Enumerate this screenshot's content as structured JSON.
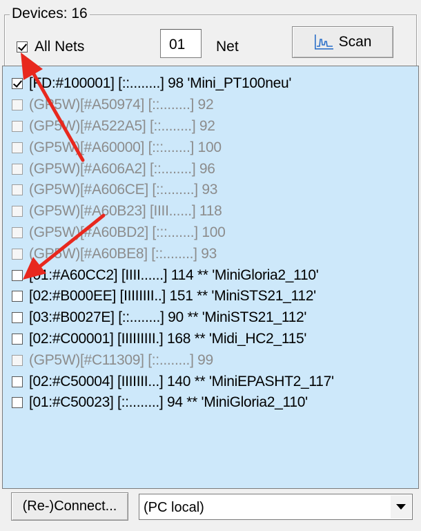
{
  "group": {
    "title": "Devices: 16"
  },
  "toolbar": {
    "all_nets_label": "All Nets",
    "all_nets_checked": true,
    "net_value": "01",
    "net_label": "Net",
    "scan_label": "Scan",
    "scan_icon": "chart-icon"
  },
  "devices": [
    {
      "label": "[FD:#100001] [::........] 98 'Mini_PT100neu'",
      "checked": true,
      "dim": false
    },
    {
      "label": "(GP5W)[#A50974] [::........] 92",
      "checked": false,
      "dim": true
    },
    {
      "label": "(GP5W)[#A522A5] [::........] 92",
      "checked": false,
      "dim": true
    },
    {
      "label": "(GP5W)[#A60000] [:::.......] 100",
      "checked": false,
      "dim": true
    },
    {
      "label": "(GP5W)[#A606A2] [::........] 96",
      "checked": false,
      "dim": true
    },
    {
      "label": "(GP5W)[#A606CE] [::........] 93",
      "checked": false,
      "dim": true
    },
    {
      "label": "(GP5W)[#A60B23] [IIII......] 118",
      "checked": false,
      "dim": true
    },
    {
      "label": "(GP5W)[#A60BD2] [:::.......] 100",
      "checked": false,
      "dim": true
    },
    {
      "label": "(GP5W)[#A60BE8] [::........] 93",
      "checked": false,
      "dim": true
    },
    {
      "label": "[01:#A60CC2] [IIII......] 114 ** 'MiniGloria2_110'",
      "checked": false,
      "dim": false
    },
    {
      "label": "[02:#B000EE] [IIIIIIII..] 151 ** 'MiniSTS21_112'",
      "checked": false,
      "dim": false
    },
    {
      "label": "[03:#B0027E] [::........] 90 ** 'MiniSTS21_112'",
      "checked": false,
      "dim": false
    },
    {
      "label": "[02:#C00001] [IIIIIIIII.] 168 ** 'Midi_HC2_115'",
      "checked": false,
      "dim": false
    },
    {
      "label": "(GP5W)[#C11309] [::........] 99",
      "checked": false,
      "dim": true
    },
    {
      "label": "[02:#C50004] [IIIIIII...] 140 ** 'MiniEPASHT2_117'",
      "checked": false,
      "dim": false
    },
    {
      "label": "[01:#C50023] [::........] 94 ** 'MiniGloria2_110'",
      "checked": false,
      "dim": false
    }
  ],
  "bottom": {
    "connect_label": "(Re-)Connect...",
    "connection_value": "(PC local)"
  },
  "colors": {
    "list_bg": "#cde8fa",
    "annotation_arrow": "#e8281e"
  }
}
